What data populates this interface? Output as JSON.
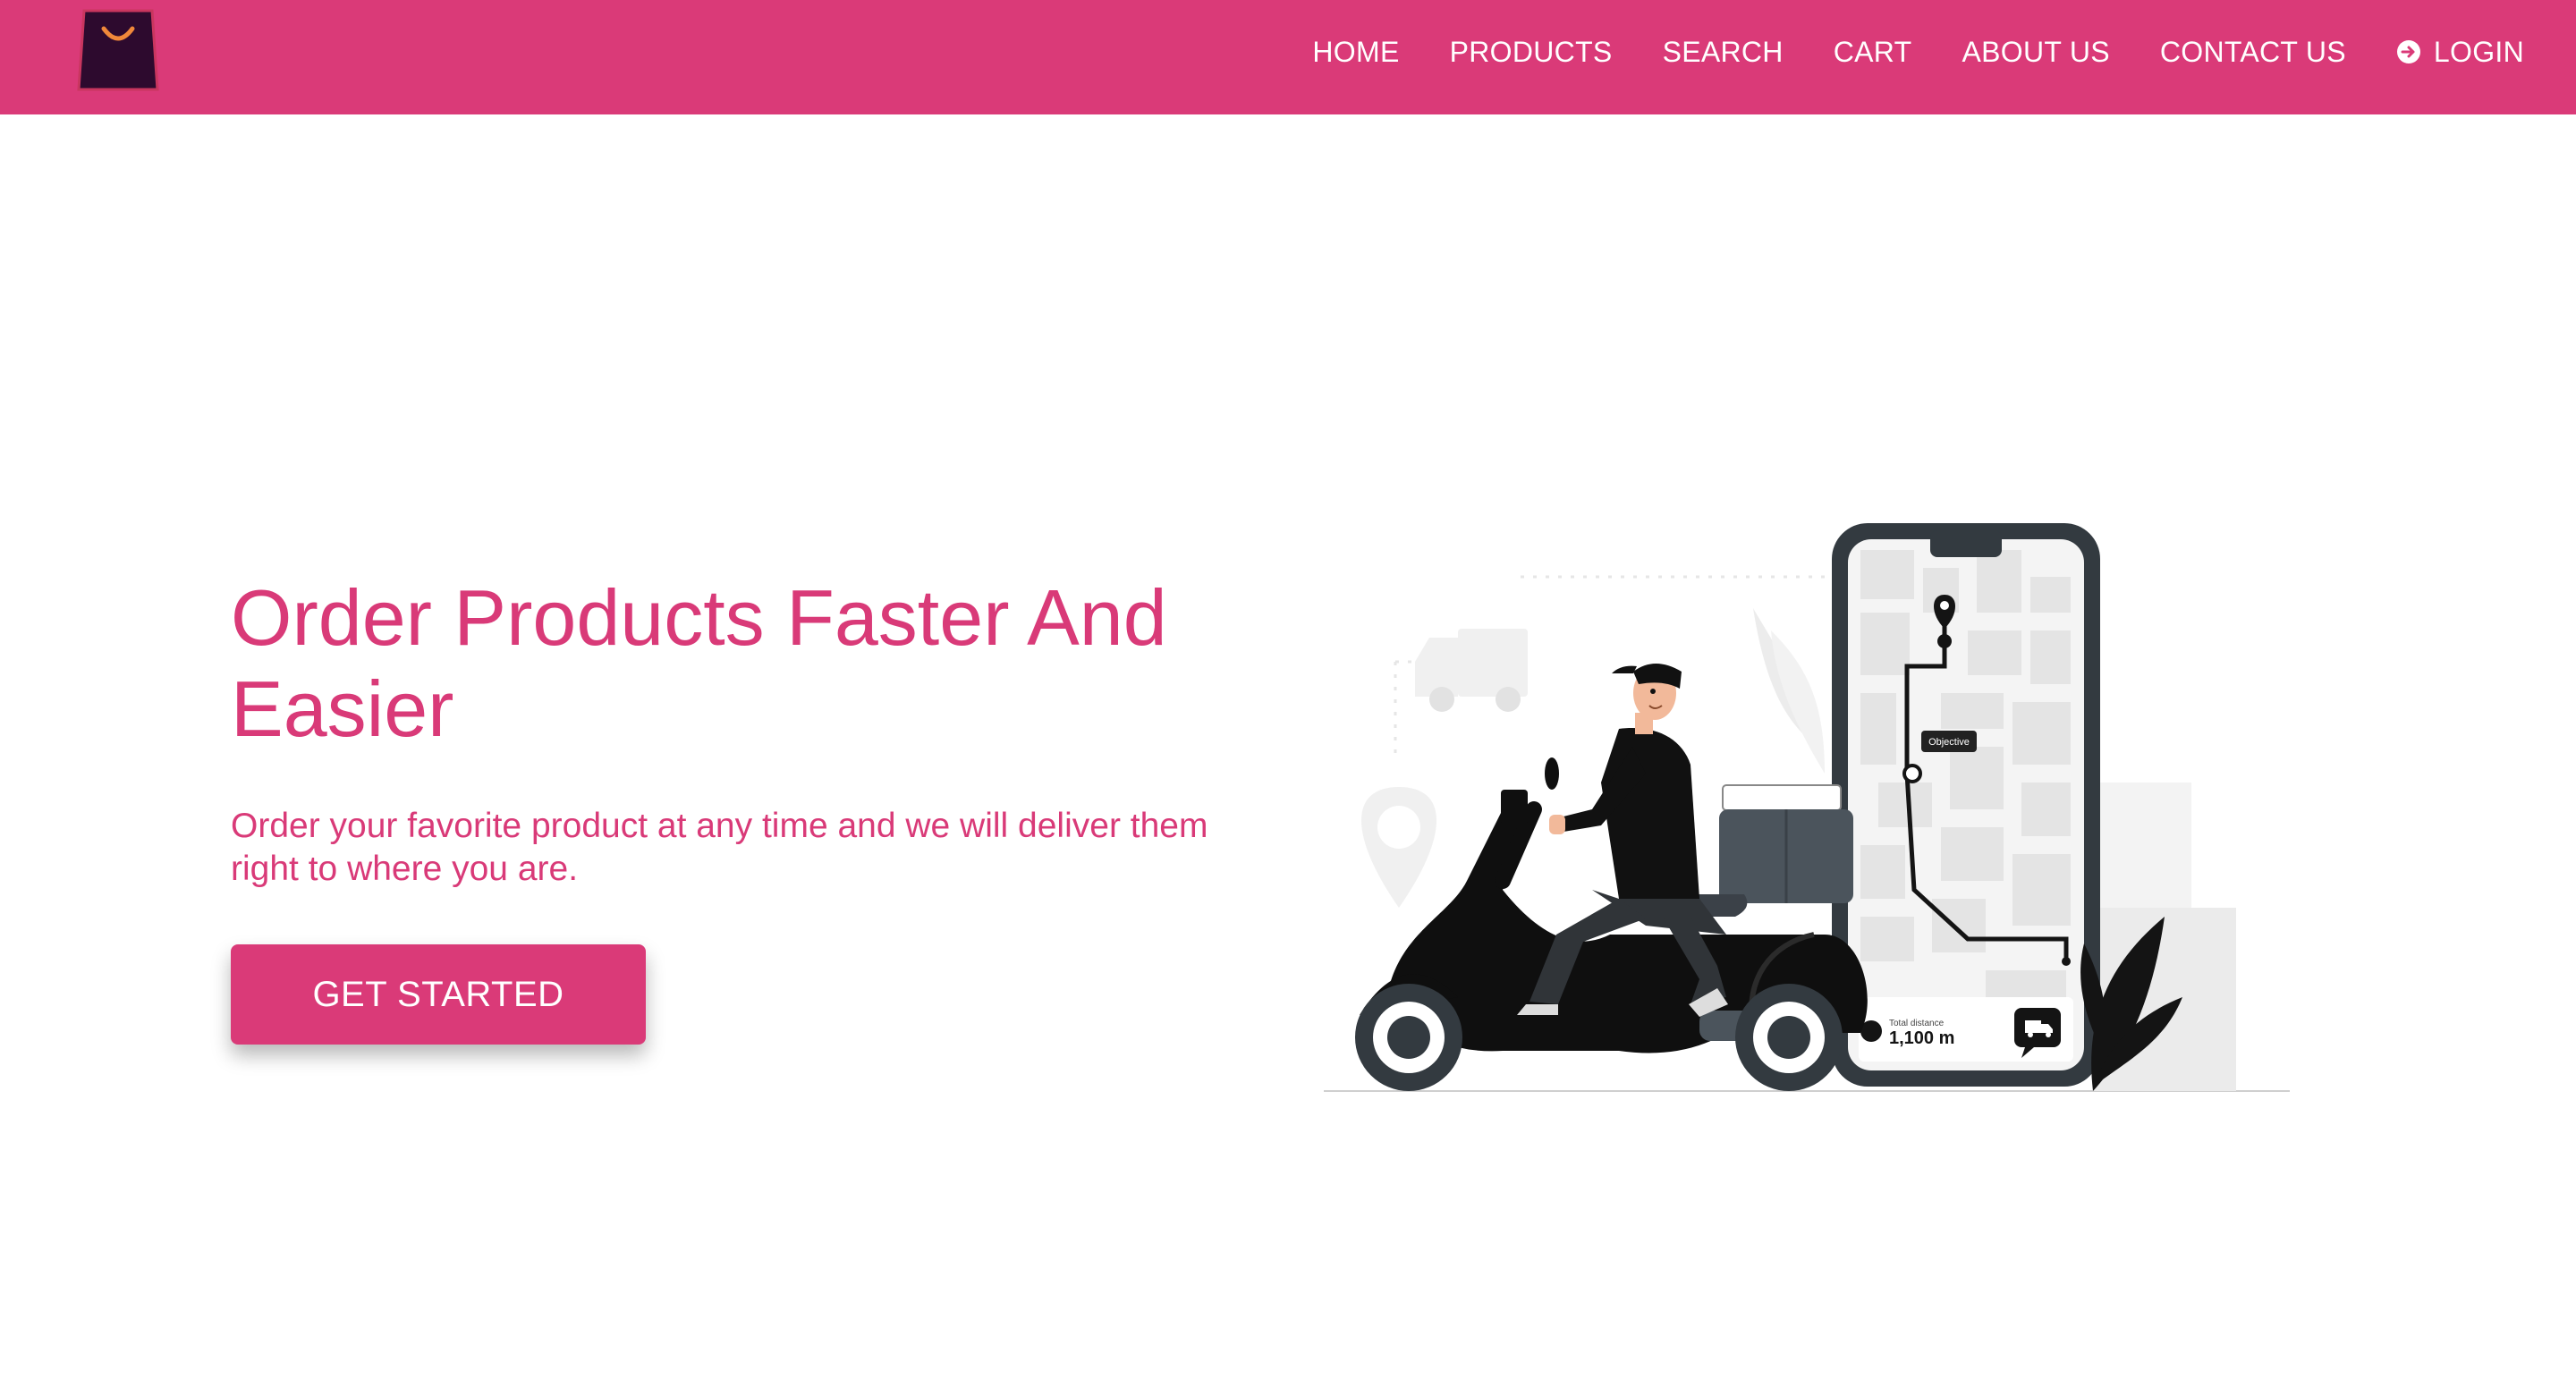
{
  "brand": {
    "logo_icon": "shopping-bag-icon"
  },
  "nav": {
    "items": [
      {
        "label": "HOME"
      },
      {
        "label": "PRODUCTS"
      },
      {
        "label": "SEARCH"
      },
      {
        "label": "CART"
      },
      {
        "label": "ABOUT US"
      },
      {
        "label": "CONTACT US"
      }
    ],
    "login": {
      "label": "LOGIN",
      "icon": "login-arrow-icon"
    }
  },
  "hero": {
    "title": "Order Products Faster And Easier",
    "subtitle": "Order your favorite product at any time and we will deliver them right to where you are.",
    "cta_label": "GET STARTED"
  },
  "illustration": {
    "objective_label": "Objective",
    "distance_caption": "Total distance",
    "distance_value": "1,100 m"
  },
  "colors": {
    "brand": "#da3a78",
    "text_accent": "#d93a78",
    "logo_dark": "#2d0a2e",
    "logo_handle": "#f0883a",
    "ink": "#141414",
    "phone_frame": "#333a40"
  }
}
